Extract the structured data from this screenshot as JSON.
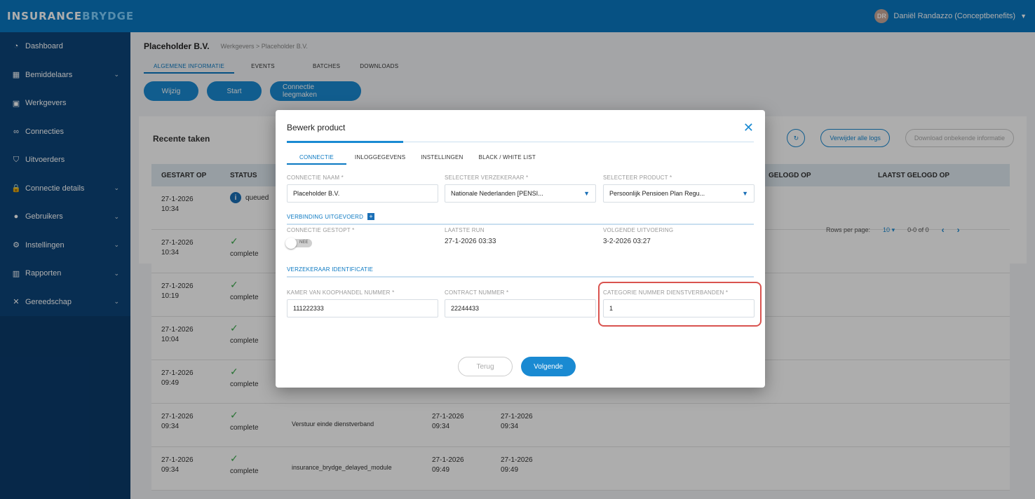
{
  "app": {
    "logo_part1": "INSURANCE",
    "logo_part2": "BRYDGE",
    "user_initials": "DR",
    "user_name": "Daniël Randazzo (Conceptbenefits)"
  },
  "sidebar": {
    "items": [
      {
        "label": "Dashboard",
        "icon": "dashboard-icon",
        "glyph": "◔",
        "expand": false
      },
      {
        "label": "Bemiddelaars",
        "icon": "building-icon",
        "glyph": "▦",
        "expand": true
      },
      {
        "label": "Werkgevers",
        "icon": "briefcase-icon",
        "glyph": "▣",
        "expand": false
      },
      {
        "label": "Connecties",
        "icon": "link-icon",
        "glyph": "∞",
        "expand": false
      },
      {
        "label": "Uitvoerders",
        "icon": "shield-icon",
        "glyph": "⛉",
        "expand": false
      },
      {
        "label": "Connectie details",
        "icon": "lock-icon",
        "glyph": "🔒",
        "expand": true
      },
      {
        "label": "Gebruikers",
        "icon": "user-icon",
        "glyph": "●",
        "expand": true
      },
      {
        "label": "Instellingen",
        "icon": "gear-icon",
        "glyph": "⚙",
        "expand": true
      },
      {
        "label": "Rapporten",
        "icon": "chart-icon",
        "glyph": "▥",
        "expand": true
      },
      {
        "label": "Gereedschap",
        "icon": "tools-icon",
        "glyph": "✕",
        "expand": true
      }
    ]
  },
  "page": {
    "title": "Placeholder B.V.",
    "breadcrumb": "Werkgevers  >  Placeholder B.V.",
    "tabs": [
      "ALGEMENE INFORMATIE",
      "EVENTS",
      "BATCHES",
      "DOWNLOADS"
    ],
    "buttons": [
      "Wijzig",
      "Start",
      "Connectie leegmaken"
    ]
  },
  "tasks": {
    "title": "Recente taken",
    "actions": [
      "Verwijder alle logs",
      "Download onbekende informatie"
    ],
    "columns": [
      "GESTART OP",
      "STATUS",
      "GELOGD OP",
      "LAATST GELOGD OP"
    ],
    "rows": [
      {
        "date": "27-1-2026",
        "time": "10:34",
        "status": "queued",
        "task": "",
        "c4d": "",
        "c4t": "",
        "c5d": "",
        "c5t": ""
      },
      {
        "date": "27-1-2026",
        "time": "10:34",
        "status": "complete",
        "task": "",
        "c4d": "",
        "c4t": "",
        "c5d": "",
        "c5t": ""
      },
      {
        "date": "27-1-2026",
        "time": "10:19",
        "status": "complete",
        "task": "",
        "c4d": "",
        "c4t": "",
        "c5d": "",
        "c5t": ""
      },
      {
        "date": "27-1-2026",
        "time": "10:04",
        "status": "complete",
        "task": "",
        "c4d": "",
        "c4t": "",
        "c5d": "",
        "c5t": ""
      },
      {
        "date": "27-1-2026",
        "time": "09:49",
        "status": "complete",
        "task": "",
        "c4d": "",
        "c4t": "",
        "c5d": "",
        "c5t": ""
      },
      {
        "date": "27-1-2026",
        "time": "09:34",
        "status": "complete",
        "task": "Verstuur einde dienstverband",
        "c4d": "27-1-2026",
        "c4t": "09:34",
        "c5d": "27-1-2026",
        "c5t": "09:34"
      },
      {
        "date": "27-1-2026",
        "time": "09:34",
        "status": "complete",
        "task": "insurance_brydge_delayed_module",
        "c4d": "27-1-2026",
        "c4t": "09:49",
        "c5d": "27-1-2026",
        "c5t": "09:49"
      }
    ],
    "pager": {
      "label": "Rows per page:",
      "value": "10",
      "range": "0-0 of 0"
    }
  },
  "modal": {
    "title": "Bewerk product",
    "tabs": [
      "CONNECTIE",
      "INLOGGEGEVENS",
      "INSTELLINGEN",
      "BLACK / WHITE LIST"
    ],
    "fields": {
      "connectie_naam": {
        "label": "CONNECTIE NAAM *",
        "value": "Placeholder B.V."
      },
      "verzekeraar": {
        "label": "SELECTEER VERZEKERAAR *",
        "value": "Nationale Nederlanden [PENSI..."
      },
      "product": {
        "label": "SELECTEER PRODUCT *",
        "value": "Persoonlijk Pensioen Plan Regu..."
      }
    },
    "section_run": "VERBINDING UITGEVOERD",
    "run": {
      "gestopt_label": "CONNECTIE GESTOPT *",
      "toggle_text": "NEE",
      "laatste_label": "LAATSTE RUN",
      "laatste_value": "27-1-2026 03:33",
      "volgende_label": "VOLGENDE UITVOERING",
      "volgende_value": "3-2-2026 03:27"
    },
    "section_id": "VERZEKERAAR IDENTIFICATIE",
    "id_fields": {
      "kvk": {
        "label": "KAMER VAN KOOPHANDEL NUMMER *",
        "value": "111222333"
      },
      "contract": {
        "label": "CONTRACT NUMMER *",
        "value": "22244433"
      },
      "categorie": {
        "label": "CATEGORIE NUMMER DIENSTVERBANDEN *",
        "value": "1"
      }
    },
    "buttons": {
      "back": "Terug",
      "next": "Volgende"
    }
  },
  "colors": {
    "primary": "#0a78c2",
    "sidebar": "#0b3b6b",
    "highlight": "#d9534f"
  }
}
